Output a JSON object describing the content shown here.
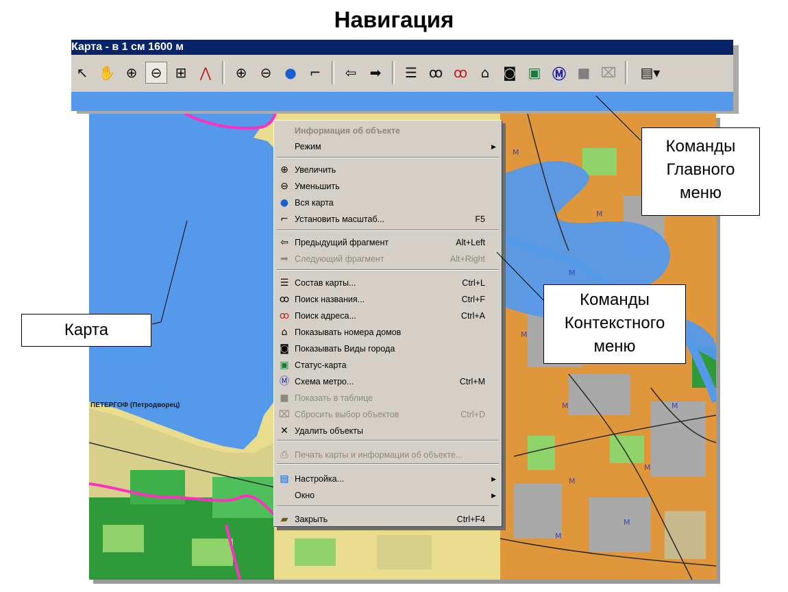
{
  "slide": {
    "title": "Навигация"
  },
  "toolbar": {
    "window_title": "Карта - в 1 см 1600 м",
    "tools": [
      {
        "icon": "pointer-arrow-icon",
        "glyph": "↖"
      },
      {
        "icon": "hand-pan-icon",
        "glyph": "✋"
      },
      {
        "icon": "zoom-in-magnifier-icon",
        "glyph": "⊕"
      },
      {
        "icon": "zoom-out-magnifier-icon",
        "glyph": "⊖"
      },
      {
        "icon": "tram-icon",
        "glyph": "🚋"
      },
      {
        "icon": "compass-measure-icon",
        "glyph": "⋀"
      },
      {
        "icon": "zoom-in-icon",
        "glyph": "⊕"
      },
      {
        "icon": "zoom-out-icon",
        "glyph": "⊖"
      },
      {
        "icon": "globe-icon",
        "glyph": "🌐"
      },
      {
        "icon": "scale-ruler-icon",
        "glyph": "📐"
      },
      {
        "icon": "back-arrow-icon",
        "glyph": "⇦"
      },
      {
        "icon": "forward-arrow-icon",
        "glyph": "➡"
      },
      {
        "icon": "layers-icon",
        "glyph": "☰"
      },
      {
        "icon": "binoculars-icon",
        "glyph": "👀"
      },
      {
        "icon": "address-search-icon",
        "glyph": "📅"
      },
      {
        "icon": "house-numbers-icon",
        "glyph": "🏠"
      },
      {
        "icon": "camera-icon",
        "glyph": "📷"
      },
      {
        "icon": "status-map-icon",
        "glyph": "🗺"
      },
      {
        "icon": "metro-icon",
        "glyph": "Ⓜ"
      },
      {
        "icon": "table-icon",
        "glyph": "■"
      },
      {
        "icon": "reset-selection-icon",
        "glyph": "⌧"
      },
      {
        "icon": "settings-dropdown-icon",
        "glyph": "🖥▾"
      }
    ]
  },
  "context_menu": {
    "items": [
      {
        "label": "Информация об объекте",
        "shortcut": "",
        "icon": "",
        "disabled": true,
        "header": true
      },
      {
        "label": "Режим",
        "shortcut": "",
        "icon": "",
        "submenu": true
      },
      {
        "label": "Увеличить",
        "shortcut": "",
        "icon": "zoom-in-icon",
        "glyph": "⊕"
      },
      {
        "label": "Уменьшить",
        "shortcut": "",
        "icon": "zoom-out-icon",
        "glyph": "⊖"
      },
      {
        "label": "Вся карта",
        "shortcut": "",
        "icon": "globe-icon",
        "glyph": "●"
      },
      {
        "label": "Установить масштаб...",
        "shortcut": "F5",
        "icon": "scale-ruler-icon",
        "glyph": "⌐"
      },
      {
        "label": "Предыдущий фрагмент",
        "shortcut": "Alt+Left",
        "icon": "back-arrow-icon",
        "glyph": "⇦"
      },
      {
        "label": "Следующий фрагмент",
        "shortcut": "Alt+Right",
        "icon": "forward-arrow-icon",
        "glyph": "➡",
        "disabled": true
      },
      {
        "label": "Состав карты...",
        "shortcut": "Ctrl+L",
        "icon": "layers-icon",
        "glyph": "☰"
      },
      {
        "label": "Поиск названия...",
        "shortcut": "Ctrl+F",
        "icon": "binoculars-icon",
        "glyph": "ꝏ"
      },
      {
        "label": "Поиск адреса...",
        "shortcut": "Ctrl+A",
        "icon": "address-search-icon",
        "glyph": "ꝏ"
      },
      {
        "label": "Показывать номера домов",
        "shortcut": "",
        "icon": "house-numbers-icon",
        "glyph": "⌂"
      },
      {
        "label": "Показывать Виды города",
        "shortcut": "",
        "icon": "camera-icon",
        "glyph": "◙"
      },
      {
        "label": "Статус-карта",
        "shortcut": "",
        "icon": "status-map-icon",
        "glyph": "▣"
      },
      {
        "label": "Схема метро...",
        "shortcut": "Ctrl+M",
        "icon": "metro-icon",
        "glyph": "Ⓜ"
      },
      {
        "label": "Показать в таблице",
        "shortcut": "",
        "icon": "table-icon",
        "glyph": "■",
        "disabled": true
      },
      {
        "label": "Сбросить выбор объектов",
        "shortcut": "Ctrl+D",
        "icon": "reset-selection-icon",
        "glyph": "⌧",
        "disabled": true
      },
      {
        "label": "Удалить объекты",
        "shortcut": "",
        "icon": "delete-x-icon",
        "glyph": "✕"
      },
      {
        "label": "Печать карты и информации об объекте...",
        "shortcut": "",
        "icon": "printer-icon",
        "glyph": "⎙",
        "disabled": true
      },
      {
        "label": "Настройка...",
        "shortcut": "",
        "icon": "settings-icon",
        "glyph": "▤",
        "submenu": true
      },
      {
        "label": "Окно",
        "shortcut": "",
        "icon": "",
        "submenu": true
      },
      {
        "label": "Закрыть",
        "shortcut": "Ctrl+F4",
        "icon": "folder-close-icon",
        "glyph": "▰"
      }
    ]
  },
  "map": {
    "place_label": "ПЕТЕРГОФ (Петродворец)",
    "colors": {
      "water": "#5599ea",
      "land": "#e9dd8d",
      "urban": "#e0963a",
      "green": "#2f9a3a",
      "boundary": "#ff2fc0"
    }
  },
  "callouts": {
    "map": "Карта",
    "main_menu": [
      "Команды",
      "Главного",
      "меню"
    ],
    "context_menu": [
      "Команды",
      "Контекстного",
      "меню"
    ]
  }
}
